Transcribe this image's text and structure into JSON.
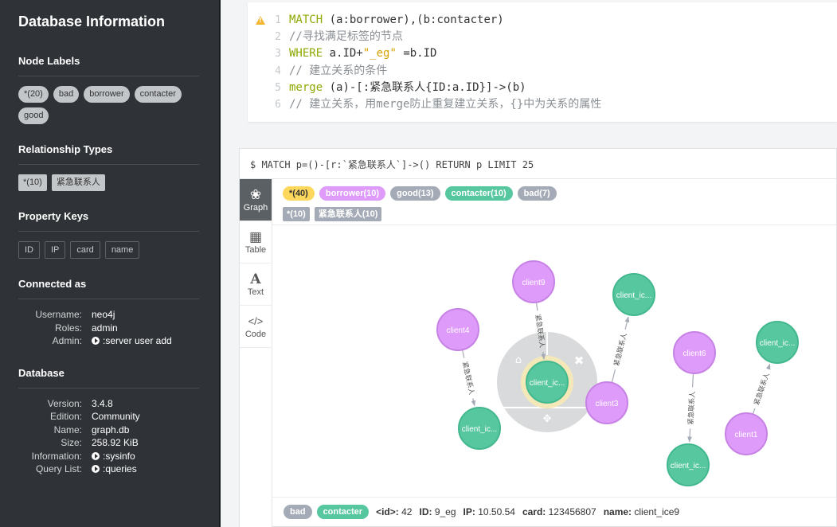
{
  "sidebar": {
    "title": "Database Information",
    "node_labels_heading": "Node Labels",
    "node_labels": [
      "*(20)",
      "bad",
      "borrower",
      "contacter",
      "good"
    ],
    "rel_types_heading": "Relationship Types",
    "rel_types": [
      "*(10)",
      "紧急联系人"
    ],
    "property_keys_heading": "Property Keys",
    "property_keys": [
      "ID",
      "IP",
      "card",
      "name"
    ],
    "connected_heading": "Connected as",
    "connected": [
      {
        "k": "Username:",
        "v": "neo4j",
        "cmd": false
      },
      {
        "k": "Roles:",
        "v": "admin",
        "cmd": false
      },
      {
        "k": "Admin:",
        "v": ":server user add",
        "cmd": true
      }
    ],
    "database_heading": "Database",
    "database": [
      {
        "k": "Version:",
        "v": "3.4.8",
        "cmd": false
      },
      {
        "k": "Edition:",
        "v": "Community",
        "cmd": false
      },
      {
        "k": "Name:",
        "v": "graph.db",
        "cmd": false
      },
      {
        "k": "Size:",
        "v": "258.92 KiB",
        "cmd": false
      },
      {
        "k": "Information:",
        "v": ":sysinfo",
        "cmd": true
      },
      {
        "k": "Query List:",
        "v": ":queries",
        "cmd": true
      }
    ]
  },
  "editor": {
    "lines": [
      {
        "num": "1",
        "tokens": [
          [
            "kw",
            "MATCH"
          ],
          [
            "txt",
            " (a:borrower),(b:contacter)"
          ]
        ]
      },
      {
        "num": "2",
        "tokens": [
          [
            "cm",
            "//寻找满足标签的节点"
          ]
        ]
      },
      {
        "num": "3",
        "tokens": [
          [
            "kw",
            "WHERE"
          ],
          [
            "txt",
            " a.ID+"
          ],
          [
            "str",
            "\"_eg\""
          ],
          [
            "txt",
            " =b.ID"
          ]
        ]
      },
      {
        "num": "4",
        "tokens": [
          [
            "cm",
            "// 建立关系的条件"
          ]
        ]
      },
      {
        "num": "5",
        "tokens": [
          [
            "kw",
            "merge"
          ],
          [
            "txt",
            " (a)-[:紧急联系人{ID:a.ID}]->(b)"
          ]
        ]
      },
      {
        "num": "6",
        "tokens": [
          [
            "cm",
            "// 建立关系，用merge防止重复建立关系，{}中为关系的属性"
          ]
        ]
      }
    ]
  },
  "frame": {
    "query": "$ MATCH p=()-[r:`紧急联系人`]->() RETURN p LIMIT 25",
    "tabs": [
      {
        "label": "Graph",
        "icon": "graph-icon",
        "glyph": "❀",
        "active": true
      },
      {
        "label": "Table",
        "icon": "table-icon",
        "glyph": "▦",
        "active": false
      },
      {
        "label": "Text",
        "icon": "text-icon",
        "glyph": "A",
        "active": false
      },
      {
        "label": "Code",
        "icon": "code-icon",
        "glyph": "</>",
        "active": false
      }
    ],
    "legend_labels": [
      {
        "text": "*(40)",
        "color": "#fdd85d",
        "fg": "#333"
      },
      {
        "text": "borrower(10)",
        "color": "#de9bf9",
        "fg": "#fff"
      },
      {
        "text": "good(13)",
        "color": "#a5abb6",
        "fg": "#fff"
      },
      {
        "text": "contacter(10)",
        "color": "#57c7a0",
        "fg": "#fff"
      },
      {
        "text": "bad(7)",
        "color": "#a5abb6",
        "fg": "#fff"
      }
    ],
    "legend_rels": [
      "*(10)",
      "紧急联系人(10)"
    ],
    "status": {
      "labels": [
        {
          "text": "bad",
          "color": "#a5abb6"
        },
        {
          "text": "contacter",
          "color": "#57c7a0"
        }
      ],
      "props": [
        {
          "k": "<id>:",
          "v": "42"
        },
        {
          "k": "ID:",
          "v": "9_eg"
        },
        {
          "k": "IP:",
          "v": "10.50.54"
        },
        {
          "k": "card:",
          "v": "123456807"
        },
        {
          "k": "name:",
          "v": "client_ice9"
        }
      ]
    }
  },
  "graph": {
    "colors": {
      "borrower": "#de9bf9",
      "borrower_stroke": "#c782e5",
      "contacter": "#57c7a0",
      "contacter_stroke": "#43b88e",
      "ring": "#d9dadb",
      "halo": "#f5e8b8"
    },
    "rel_label": "紧急联系人",
    "nodes": [
      {
        "id": "client9",
        "label": "client9",
        "kind": "borrower"
      },
      {
        "id": "client4",
        "label": "client4",
        "kind": "borrower"
      },
      {
        "id": "client3",
        "label": "client3",
        "kind": "borrower"
      },
      {
        "id": "client6",
        "label": "client6",
        "kind": "borrower"
      },
      {
        "id": "client1",
        "label": "client1",
        "kind": "borrower"
      },
      {
        "id": "ice9",
        "label": "client_ic...",
        "kind": "contacter",
        "selected": true
      },
      {
        "id": "ice4",
        "label": "client_ic...",
        "kind": "contacter"
      },
      {
        "id": "ice3",
        "label": "client_ic...",
        "kind": "contacter"
      },
      {
        "id": "ice6",
        "label": "client_ic...",
        "kind": "contacter"
      },
      {
        "id": "ice1",
        "label": "client_ic...",
        "kind": "contacter"
      }
    ],
    "edges": [
      {
        "from": "client9",
        "to": "ice9"
      },
      {
        "from": "client4",
        "to": "ice4"
      },
      {
        "from": "client3",
        "to": "ice3"
      },
      {
        "from": "client6",
        "to": "ice6"
      },
      {
        "from": "client1",
        "to": "ice1"
      }
    ]
  }
}
